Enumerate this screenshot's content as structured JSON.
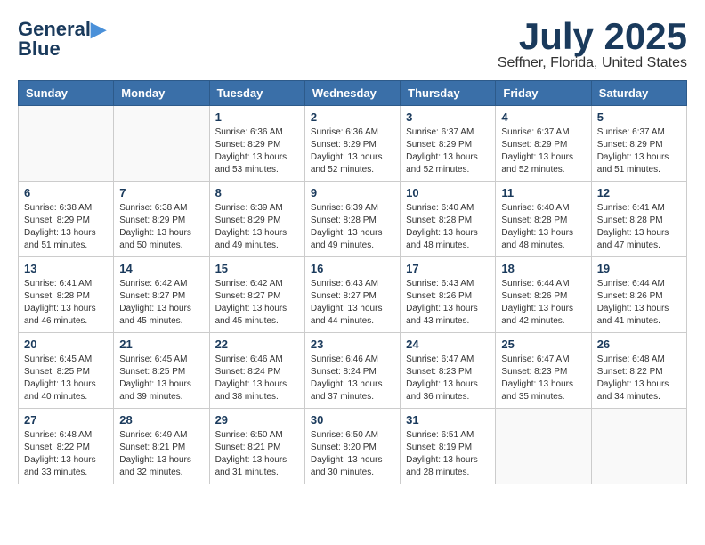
{
  "logo": {
    "line1": "General",
    "line2": "Blue"
  },
  "title": "July 2025",
  "subtitle": "Seffner, Florida, United States",
  "days_of_week": [
    "Sunday",
    "Monday",
    "Tuesday",
    "Wednesday",
    "Thursday",
    "Friday",
    "Saturday"
  ],
  "weeks": [
    [
      {
        "day": "",
        "info": ""
      },
      {
        "day": "",
        "info": ""
      },
      {
        "day": "1",
        "info": "Sunrise: 6:36 AM\nSunset: 8:29 PM\nDaylight: 13 hours and 53 minutes."
      },
      {
        "day": "2",
        "info": "Sunrise: 6:36 AM\nSunset: 8:29 PM\nDaylight: 13 hours and 52 minutes."
      },
      {
        "day": "3",
        "info": "Sunrise: 6:37 AM\nSunset: 8:29 PM\nDaylight: 13 hours and 52 minutes."
      },
      {
        "day": "4",
        "info": "Sunrise: 6:37 AM\nSunset: 8:29 PM\nDaylight: 13 hours and 52 minutes."
      },
      {
        "day": "5",
        "info": "Sunrise: 6:37 AM\nSunset: 8:29 PM\nDaylight: 13 hours and 51 minutes."
      }
    ],
    [
      {
        "day": "6",
        "info": "Sunrise: 6:38 AM\nSunset: 8:29 PM\nDaylight: 13 hours and 51 minutes."
      },
      {
        "day": "7",
        "info": "Sunrise: 6:38 AM\nSunset: 8:29 PM\nDaylight: 13 hours and 50 minutes."
      },
      {
        "day": "8",
        "info": "Sunrise: 6:39 AM\nSunset: 8:29 PM\nDaylight: 13 hours and 49 minutes."
      },
      {
        "day": "9",
        "info": "Sunrise: 6:39 AM\nSunset: 8:28 PM\nDaylight: 13 hours and 49 minutes."
      },
      {
        "day": "10",
        "info": "Sunrise: 6:40 AM\nSunset: 8:28 PM\nDaylight: 13 hours and 48 minutes."
      },
      {
        "day": "11",
        "info": "Sunrise: 6:40 AM\nSunset: 8:28 PM\nDaylight: 13 hours and 48 minutes."
      },
      {
        "day": "12",
        "info": "Sunrise: 6:41 AM\nSunset: 8:28 PM\nDaylight: 13 hours and 47 minutes."
      }
    ],
    [
      {
        "day": "13",
        "info": "Sunrise: 6:41 AM\nSunset: 8:28 PM\nDaylight: 13 hours and 46 minutes."
      },
      {
        "day": "14",
        "info": "Sunrise: 6:42 AM\nSunset: 8:27 PM\nDaylight: 13 hours and 45 minutes."
      },
      {
        "day": "15",
        "info": "Sunrise: 6:42 AM\nSunset: 8:27 PM\nDaylight: 13 hours and 45 minutes."
      },
      {
        "day": "16",
        "info": "Sunrise: 6:43 AM\nSunset: 8:27 PM\nDaylight: 13 hours and 44 minutes."
      },
      {
        "day": "17",
        "info": "Sunrise: 6:43 AM\nSunset: 8:26 PM\nDaylight: 13 hours and 43 minutes."
      },
      {
        "day": "18",
        "info": "Sunrise: 6:44 AM\nSunset: 8:26 PM\nDaylight: 13 hours and 42 minutes."
      },
      {
        "day": "19",
        "info": "Sunrise: 6:44 AM\nSunset: 8:26 PM\nDaylight: 13 hours and 41 minutes."
      }
    ],
    [
      {
        "day": "20",
        "info": "Sunrise: 6:45 AM\nSunset: 8:25 PM\nDaylight: 13 hours and 40 minutes."
      },
      {
        "day": "21",
        "info": "Sunrise: 6:45 AM\nSunset: 8:25 PM\nDaylight: 13 hours and 39 minutes."
      },
      {
        "day": "22",
        "info": "Sunrise: 6:46 AM\nSunset: 8:24 PM\nDaylight: 13 hours and 38 minutes."
      },
      {
        "day": "23",
        "info": "Sunrise: 6:46 AM\nSunset: 8:24 PM\nDaylight: 13 hours and 37 minutes."
      },
      {
        "day": "24",
        "info": "Sunrise: 6:47 AM\nSunset: 8:23 PM\nDaylight: 13 hours and 36 minutes."
      },
      {
        "day": "25",
        "info": "Sunrise: 6:47 AM\nSunset: 8:23 PM\nDaylight: 13 hours and 35 minutes."
      },
      {
        "day": "26",
        "info": "Sunrise: 6:48 AM\nSunset: 8:22 PM\nDaylight: 13 hours and 34 minutes."
      }
    ],
    [
      {
        "day": "27",
        "info": "Sunrise: 6:48 AM\nSunset: 8:22 PM\nDaylight: 13 hours and 33 minutes."
      },
      {
        "day": "28",
        "info": "Sunrise: 6:49 AM\nSunset: 8:21 PM\nDaylight: 13 hours and 32 minutes."
      },
      {
        "day": "29",
        "info": "Sunrise: 6:50 AM\nSunset: 8:21 PM\nDaylight: 13 hours and 31 minutes."
      },
      {
        "day": "30",
        "info": "Sunrise: 6:50 AM\nSunset: 8:20 PM\nDaylight: 13 hours and 30 minutes."
      },
      {
        "day": "31",
        "info": "Sunrise: 6:51 AM\nSunset: 8:19 PM\nDaylight: 13 hours and 28 minutes."
      },
      {
        "day": "",
        "info": ""
      },
      {
        "day": "",
        "info": ""
      }
    ]
  ]
}
